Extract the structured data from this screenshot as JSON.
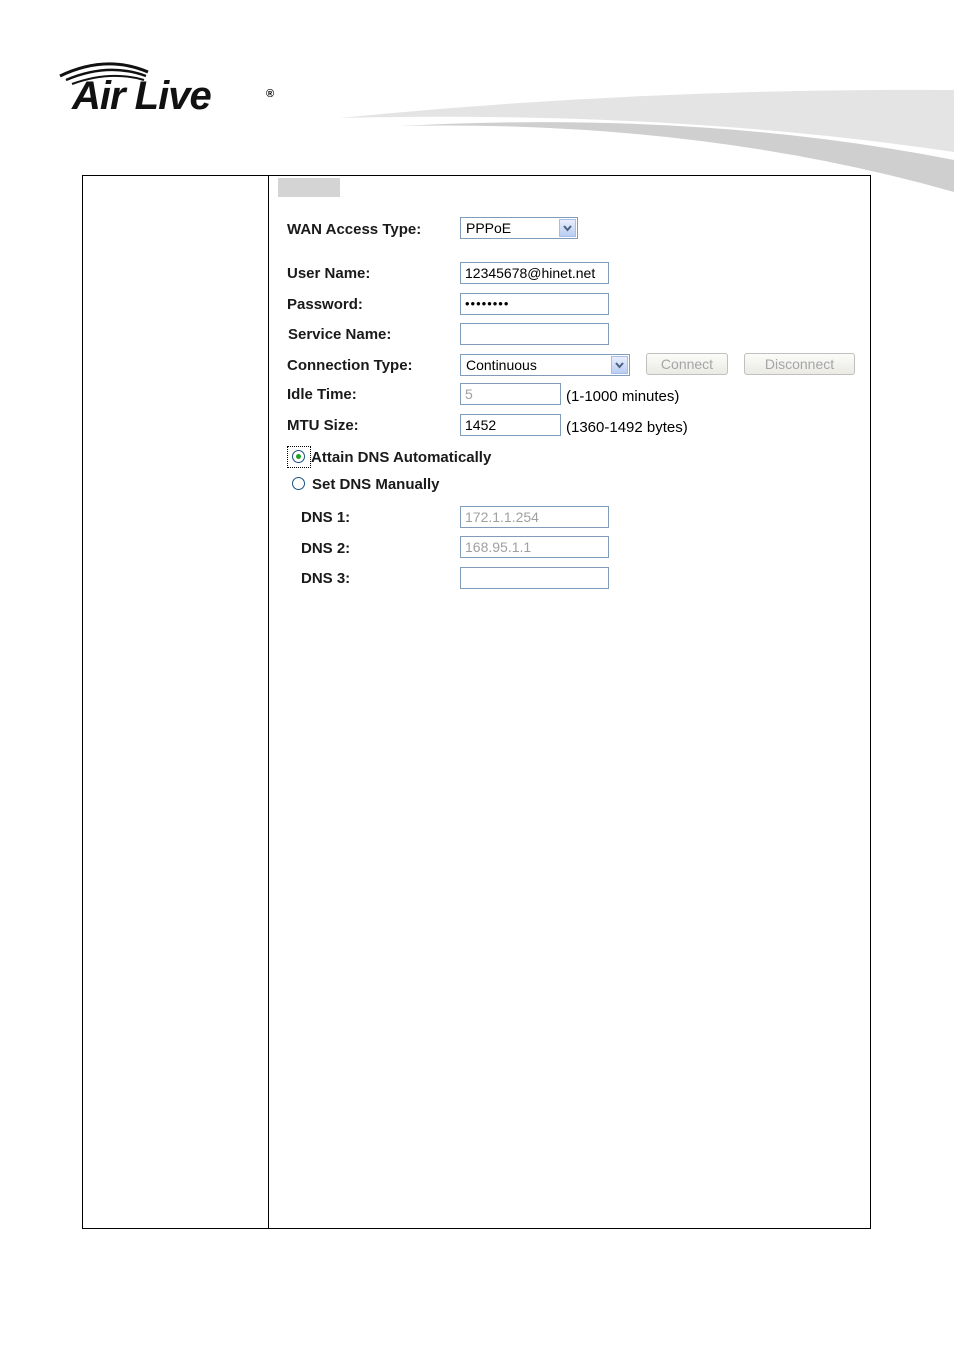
{
  "brand": {
    "logo_text": "Air Live",
    "registered_mark": "®"
  },
  "form": {
    "wan_access_type": {
      "label": "WAN Access Type:",
      "value": "PPPoE"
    },
    "user_name": {
      "label": "User Name:",
      "value": "12345678@hinet.net"
    },
    "password": {
      "label": "Password:",
      "value": "••••••••"
    },
    "service_name": {
      "label": "Service Name:",
      "value": ""
    },
    "connection_type": {
      "label": "Connection Type:",
      "value": "Continuous"
    },
    "connect_button": "Connect",
    "disconnect_button": "Disconnect",
    "idle_time": {
      "label": "Idle Time:",
      "value": "5",
      "hint": "(1-1000 minutes)"
    },
    "mtu_size": {
      "label": "MTU Size:",
      "value": "1452",
      "hint": "(1360-1492 bytes)"
    },
    "dns_auto": {
      "label": "Attain DNS Automatically",
      "selected": true
    },
    "dns_manual": {
      "label": "Set DNS Manually",
      "selected": false
    },
    "dns1": {
      "label": "DNS 1:",
      "value": "172.1.1.254"
    },
    "dns2": {
      "label": "DNS 2:",
      "value": "168.95.1.1"
    },
    "dns3": {
      "label": "DNS 3:",
      "value": ""
    }
  },
  "colors": {
    "input_border": "#7f9db9",
    "radio_dot": "#21a121",
    "disabled_text": "#a0a0a0"
  }
}
